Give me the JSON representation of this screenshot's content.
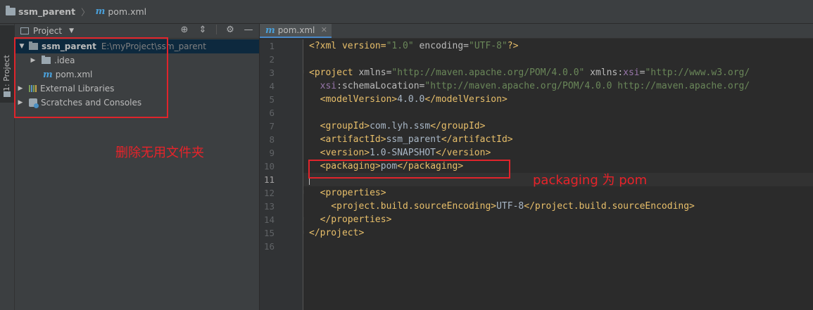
{
  "breadcrumb": {
    "project": "ssm_parent",
    "file": "pom.xml",
    "file_icon": "m"
  },
  "toolstrip": {
    "label": "1: Project"
  },
  "project_panel": {
    "title": "Project",
    "tree": {
      "root": {
        "name": "ssm_parent",
        "path": "E:\\myProject\\ssm_parent"
      },
      "idea": ".idea",
      "pom": "pom.xml",
      "libraries": "External Libraries",
      "scratches": "Scratches and Consoles"
    },
    "annotation": "删除无用文件夹"
  },
  "editor": {
    "tab_label": "pom.xml",
    "tab_icon": "m",
    "line_numbers": [
      "1",
      "2",
      "3",
      "4",
      "5",
      "6",
      "7",
      "8",
      "9",
      "10",
      "11",
      "12",
      "13",
      "14",
      "15",
      "16"
    ],
    "current_line": "11",
    "annotation": "packaging 为 pom",
    "code": {
      "l1": {
        "a": "<?xml version=",
        "b": "\"1.0\"",
        "c": " encoding=",
        "d": "\"UTF-8\"",
        "e": "?>"
      },
      "l3": {
        "a": "<project ",
        "b": "xmlns",
        "c": "=",
        "d": "\"http://maven.apache.org/POM/4.0.0\"",
        "e": " xmlns:",
        "f": "xsi",
        "g": "=",
        "h": "\"http://www.w3.org/"
      },
      "l4": {
        "a": "  xsi",
        "b": ":schemaLocation",
        "c": "=",
        "d": "\"http://maven.apache.org/POM/4.0.0 http://maven.apache.org/"
      },
      "l5": {
        "a": "  <modelVersion>",
        "b": "4.0.0",
        "c": "</modelVersion>"
      },
      "l7": {
        "a": "  <groupId>",
        "b": "com.lyh.ssm",
        "c": "</groupId>"
      },
      "l8": {
        "a": "  <artifactId>",
        "b": "ssm_parent",
        "c": "</artifactId>"
      },
      "l9": {
        "a": "  <version>",
        "b": "1.0-SNAPSHOT",
        "c": "</version>"
      },
      "l10": {
        "a": "  <packaging>",
        "b": "pom",
        "c": "</packaging>"
      },
      "l12": {
        "a": "  <properties>"
      },
      "l13": {
        "a": "    <project.build.sourceEncoding>",
        "b": "UTF-8",
        "c": "</project.build.sourceEncoding>"
      },
      "l14": {
        "a": "  </properties>"
      },
      "l15": {
        "a": "</project>"
      }
    }
  },
  "colors": {
    "annotation_red": "#e0242b",
    "tag": "#e8bf6a",
    "string": "#6a8759",
    "namespace": "#9876aa"
  }
}
